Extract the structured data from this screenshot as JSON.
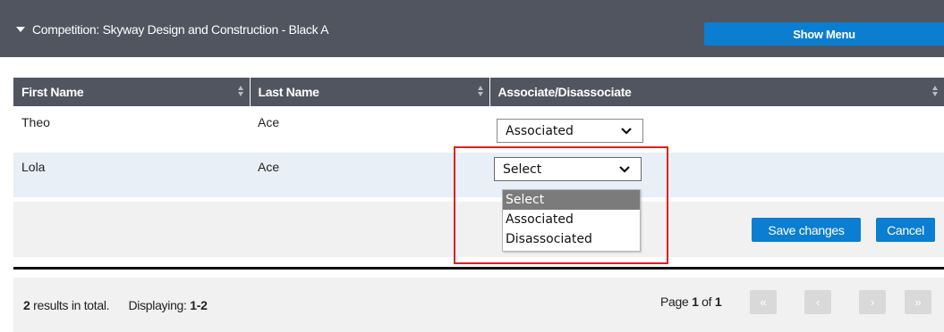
{
  "header": {
    "competition_label": "Competition: Skyway Design and Construction - Black A",
    "show_menu_label": "Show Menu",
    "collapse_icon": "caret-down-icon"
  },
  "table": {
    "columns": [
      "First Name",
      "Last Name",
      "Associate/Disassociate"
    ],
    "rows": [
      {
        "first_name": "Theo",
        "last_name": "Ace",
        "association": "Associated"
      },
      {
        "first_name": "Lola",
        "last_name": "Ace",
        "association": "Select"
      }
    ]
  },
  "dropdown": {
    "options": [
      "Select",
      "Associated",
      "Disassociated"
    ],
    "highlighted": "Select"
  },
  "actions": {
    "save_label": "Save changes",
    "cancel_label": "Cancel"
  },
  "pager": {
    "total_count": "2",
    "total_suffix": " results in total.",
    "displaying_prefix": "Displaying: ",
    "displaying_range": "1-2",
    "page_prefix": "Page ",
    "page_current": "1",
    "page_of": " of ",
    "page_total": "1",
    "buttons": [
      "«",
      "‹",
      "›",
      "»"
    ]
  },
  "colors": {
    "header_bg": "#505560",
    "accent_blue": "#0b7ed1",
    "row_alt": "#e9eff6",
    "highlight_red": "#e0201c"
  }
}
